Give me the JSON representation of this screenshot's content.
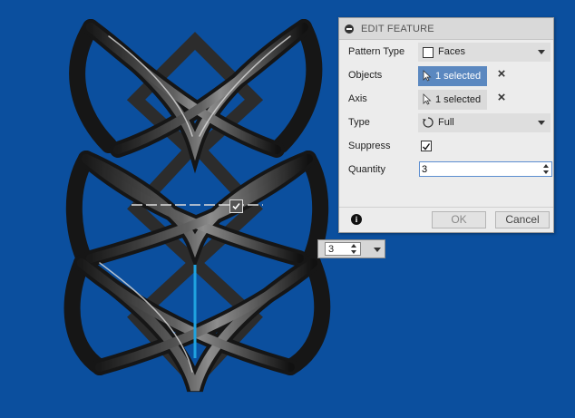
{
  "dialog": {
    "title": "EDIT FEATURE",
    "rows": {
      "pattern_type": {
        "label": "Pattern Type",
        "value": "Faces"
      },
      "objects": {
        "label": "Objects",
        "value": "1 selected"
      },
      "axis": {
        "label": "Axis",
        "value": "1 selected"
      },
      "type": {
        "label": "Type",
        "value": "Full"
      },
      "suppress": {
        "label": "Suppress",
        "checked": true
      },
      "quantity": {
        "label": "Quantity",
        "value": "3"
      }
    },
    "buttons": {
      "ok": "OK",
      "cancel": "Cancel"
    }
  },
  "manipulator": {
    "quantity": "3"
  },
  "colors": {
    "background": "#0b4f9e",
    "selection": "#5b88c0",
    "axis_line": "#1fa3e0"
  }
}
